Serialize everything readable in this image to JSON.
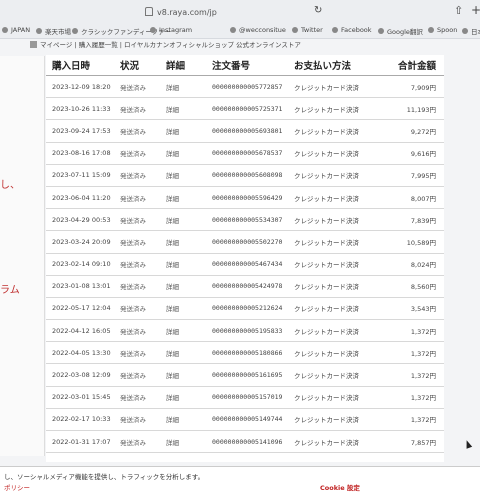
{
  "browser": {
    "url": "v8.raya.com/jp"
  },
  "bookmarks": [
    {
      "label": "JAPAN"
    },
    {
      "label": "楽天市場"
    },
    {
      "label": "クラシックファンディーファー"
    },
    {
      "label": "Instagram"
    },
    {
      "label": "@wecconsitue"
    },
    {
      "label": "Twitter"
    },
    {
      "label": "Facebook"
    },
    {
      "label": "Google翻訳"
    },
    {
      "label": "Spoon"
    },
    {
      "label": "日本"
    }
  ],
  "subbar": {
    "text": "マイページ | 購入履歴一覧 | ロイヤルカナンオフィシャルショップ 公式オンラインストア"
  },
  "left": {
    "fragment1": "し、",
    "fragment2": "ラム"
  },
  "table": {
    "headers": [
      "購入日時",
      "状況",
      "詳細",
      "注文番号",
      "お支払い方法",
      "合計金額"
    ],
    "rows": [
      {
        "date": "2023-12-09 18:20",
        "status": "発送済み",
        "detail": "詳細",
        "order": "000000000005772857",
        "payment": "クレジットカード決済",
        "amount": "7,909円"
      },
      {
        "date": "2023-10-26 11:33",
        "status": "発送済み",
        "detail": "詳細",
        "order": "000000000005725371",
        "payment": "クレジットカード決済",
        "amount": "11,193円"
      },
      {
        "date": "2023-09-24 17:53",
        "status": "発送済み",
        "detail": "詳細",
        "order": "000000000005693801",
        "payment": "クレジットカード決済",
        "amount": "9,272円"
      },
      {
        "date": "2023-08-16 17:08",
        "status": "発送済み",
        "detail": "詳細",
        "order": "000000000005678537",
        "payment": "クレジットカード決済",
        "amount": "9,616円"
      },
      {
        "date": "2023-07-11 15:09",
        "status": "発送済み",
        "detail": "詳細",
        "order": "000000000005608098",
        "payment": "クレジットカード決済",
        "amount": "7,995円"
      },
      {
        "date": "2023-06-04 11:20",
        "status": "発送済み",
        "detail": "詳細",
        "order": "000000000005596429",
        "payment": "クレジットカード決済",
        "amount": "8,007円"
      },
      {
        "date": "2023-04-29 00:53",
        "status": "発送済み",
        "detail": "詳細",
        "order": "000000000005534307",
        "payment": "クレジットカード決済",
        "amount": "7,839円"
      },
      {
        "date": "2023-03-24 20:09",
        "status": "発送済み",
        "detail": "詳細",
        "order": "000000000005502270",
        "payment": "クレジットカード決済",
        "amount": "10,589円"
      },
      {
        "date": "2023-02-14 09:10",
        "status": "発送済み",
        "detail": "詳細",
        "order": "000000000005467434",
        "payment": "クレジットカード決済",
        "amount": "8,024円"
      },
      {
        "date": "2023-01-08 13:01",
        "status": "発送済み",
        "detail": "詳細",
        "order": "000000000005424978",
        "payment": "クレジットカード決済",
        "amount": "8,560円"
      },
      {
        "date": "2022-05-17 12:04",
        "status": "発送済み",
        "detail": "詳細",
        "order": "000000000005212624",
        "payment": "クレジットカード決済",
        "amount": "3,543円"
      },
      {
        "date": "2022-04-12 16:05",
        "status": "発送済み",
        "detail": "詳細",
        "order": "000000000005195833",
        "payment": "クレジットカード決済",
        "amount": "1,372円"
      },
      {
        "date": "2022-04-05 13:30",
        "status": "発送済み",
        "detail": "詳細",
        "order": "000000000005180866",
        "payment": "クレジットカード決済",
        "amount": "1,372円"
      },
      {
        "date": "2022-03-08 12:09",
        "status": "発送済み",
        "detail": "詳細",
        "order": "000000000005161695",
        "payment": "クレジットカード決済",
        "amount": "1,372円"
      },
      {
        "date": "2022-03-01 15:45",
        "status": "発送済み",
        "detail": "詳細",
        "order": "000000000005157019",
        "payment": "クレジットカード決済",
        "amount": "1,372円"
      },
      {
        "date": "2022-02-17 10:33",
        "status": "発送済み",
        "detail": "詳細",
        "order": "000000000005149744",
        "payment": "クレジットカード決済",
        "amount": "1,372円"
      },
      {
        "date": "2022-01-31 17:07",
        "status": "発送済み",
        "detail": "詳細",
        "order": "000000000005141096",
        "payment": "クレジットカード決済",
        "amount": "7,857円"
      }
    ]
  },
  "cookie": {
    "text": "し、ソーシャルメディア機能を提供し、トラフィックを分析します。",
    "policy": "ポリシー",
    "settings": "Cookie 設定"
  }
}
